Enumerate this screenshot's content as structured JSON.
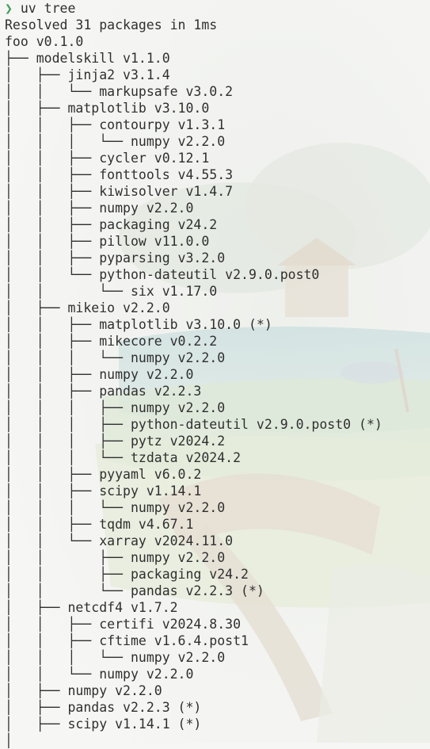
{
  "prompt": {
    "symbol": "❯",
    "command": "uv tree"
  },
  "colors": {
    "prompt_symbol": "#3e9e5a",
    "text": "#2f2f2f",
    "background": "#f6f6f4"
  },
  "output": [
    {
      "prefix": "",
      "name": "Resolved 31 packages in 1ms"
    },
    {
      "prefix": "",
      "name": "foo v0.1.0"
    },
    {
      "prefix": "├── ",
      "name": "modelskill v1.1.0"
    },
    {
      "prefix": "│   ├── ",
      "name": "jinja2 v3.1.4"
    },
    {
      "prefix": "│   │   └── ",
      "name": "markupsafe v3.0.2"
    },
    {
      "prefix": "│   ├── ",
      "name": "matplotlib v3.10.0"
    },
    {
      "prefix": "│   │   ├── ",
      "name": "contourpy v1.3.1"
    },
    {
      "prefix": "│   │   │   └── ",
      "name": "numpy v2.2.0"
    },
    {
      "prefix": "│   │   ├── ",
      "name": "cycler v0.12.1"
    },
    {
      "prefix": "│   │   ├── ",
      "name": "fonttools v4.55.3"
    },
    {
      "prefix": "│   │   ├── ",
      "name": "kiwisolver v1.4.7"
    },
    {
      "prefix": "│   │   ├── ",
      "name": "numpy v2.2.0"
    },
    {
      "prefix": "│   │   ├── ",
      "name": "packaging v24.2"
    },
    {
      "prefix": "│   │   ├── ",
      "name": "pillow v11.0.0"
    },
    {
      "prefix": "│   │   ├── ",
      "name": "pyparsing v3.2.0"
    },
    {
      "prefix": "│   │   └── ",
      "name": "python-dateutil v2.9.0.post0"
    },
    {
      "prefix": "│   │       └── ",
      "name": "six v1.17.0"
    },
    {
      "prefix": "│   ├── ",
      "name": "mikeio v2.2.0"
    },
    {
      "prefix": "│   │   ├── ",
      "name": "matplotlib v3.10.0 (*)"
    },
    {
      "prefix": "│   │   ├── ",
      "name": "mikecore v0.2.2"
    },
    {
      "prefix": "│   │   │   └── ",
      "name": "numpy v2.2.0"
    },
    {
      "prefix": "│   │   ├── ",
      "name": "numpy v2.2.0"
    },
    {
      "prefix": "│   │   ├── ",
      "name": "pandas v2.2.3"
    },
    {
      "prefix": "│   │   │   ├── ",
      "name": "numpy v2.2.0"
    },
    {
      "prefix": "│   │   │   ├── ",
      "name": "python-dateutil v2.9.0.post0 (*)"
    },
    {
      "prefix": "│   │   │   ├── ",
      "name": "pytz v2024.2"
    },
    {
      "prefix": "│   │   │   └── ",
      "name": "tzdata v2024.2"
    },
    {
      "prefix": "│   │   ├── ",
      "name": "pyyaml v6.0.2"
    },
    {
      "prefix": "│   │   ├── ",
      "name": "scipy v1.14.1"
    },
    {
      "prefix": "│   │   │   └── ",
      "name": "numpy v2.2.0"
    },
    {
      "prefix": "│   │   ├── ",
      "name": "tqdm v4.67.1"
    },
    {
      "prefix": "│   │   └── ",
      "name": "xarray v2024.11.0"
    },
    {
      "prefix": "│   │       ├── ",
      "name": "numpy v2.2.0"
    },
    {
      "prefix": "│   │       ├── ",
      "name": "packaging v24.2"
    },
    {
      "prefix": "│   │       └── ",
      "name": "pandas v2.2.3 (*)"
    },
    {
      "prefix": "│   ├── ",
      "name": "netcdf4 v1.7.2"
    },
    {
      "prefix": "│   │   ├── ",
      "name": "certifi v2024.8.30"
    },
    {
      "prefix": "│   │   ├── ",
      "name": "cftime v1.6.4.post1"
    },
    {
      "prefix": "│   │   │   └── ",
      "name": "numpy v2.2.0"
    },
    {
      "prefix": "│   │   └── ",
      "name": "numpy v2.2.0"
    },
    {
      "prefix": "│   ├── ",
      "name": "numpy v2.2.0"
    },
    {
      "prefix": "│   ├── ",
      "name": "pandas v2.2.3 (*)"
    },
    {
      "prefix": "│   ├── ",
      "name": "scipy v1.14.1 (*)"
    },
    {
      "prefix": "│",
      "name": ""
    }
  ]
}
